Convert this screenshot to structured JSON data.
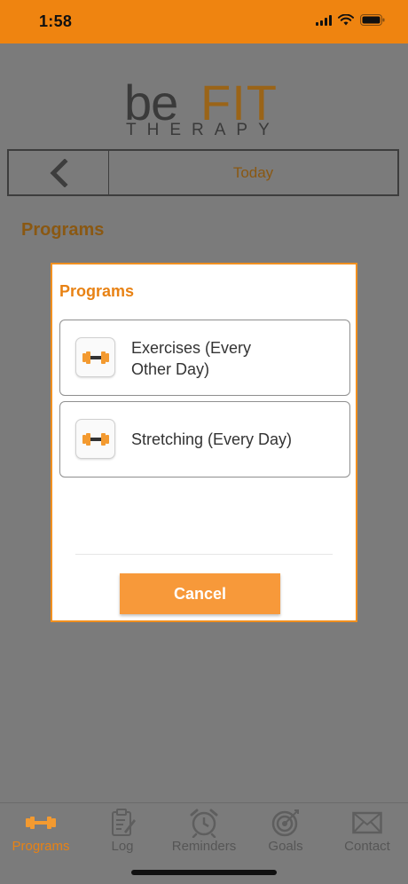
{
  "status_bar": {
    "time": "1:58"
  },
  "logo": {
    "be": "be",
    "fit": "FIT",
    "therapy": "THERAPY"
  },
  "nav": {
    "title": "Today"
  },
  "page": {
    "section_title": "Programs"
  },
  "modal": {
    "title": "Programs",
    "items": [
      {
        "label": "Exercises (Every Other Day)"
      },
      {
        "label": "Stretching (Every Day)"
      }
    ],
    "cancel_label": "Cancel"
  },
  "tabs": [
    {
      "label": "Programs",
      "icon": "dumbbell-icon",
      "active": true
    },
    {
      "label": "Log",
      "icon": "clipboard-icon",
      "active": false
    },
    {
      "label": "Reminders",
      "icon": "alarm-clock-icon",
      "active": false
    },
    {
      "label": "Goals",
      "icon": "target-icon",
      "active": false
    },
    {
      "label": "Contact",
      "icon": "envelope-icon",
      "active": false
    }
  ],
  "colors": {
    "accent": "#ef8410",
    "overlay": "#7b7b7b",
    "brand_brown": "#8a5812",
    "button": "#f7993a"
  }
}
